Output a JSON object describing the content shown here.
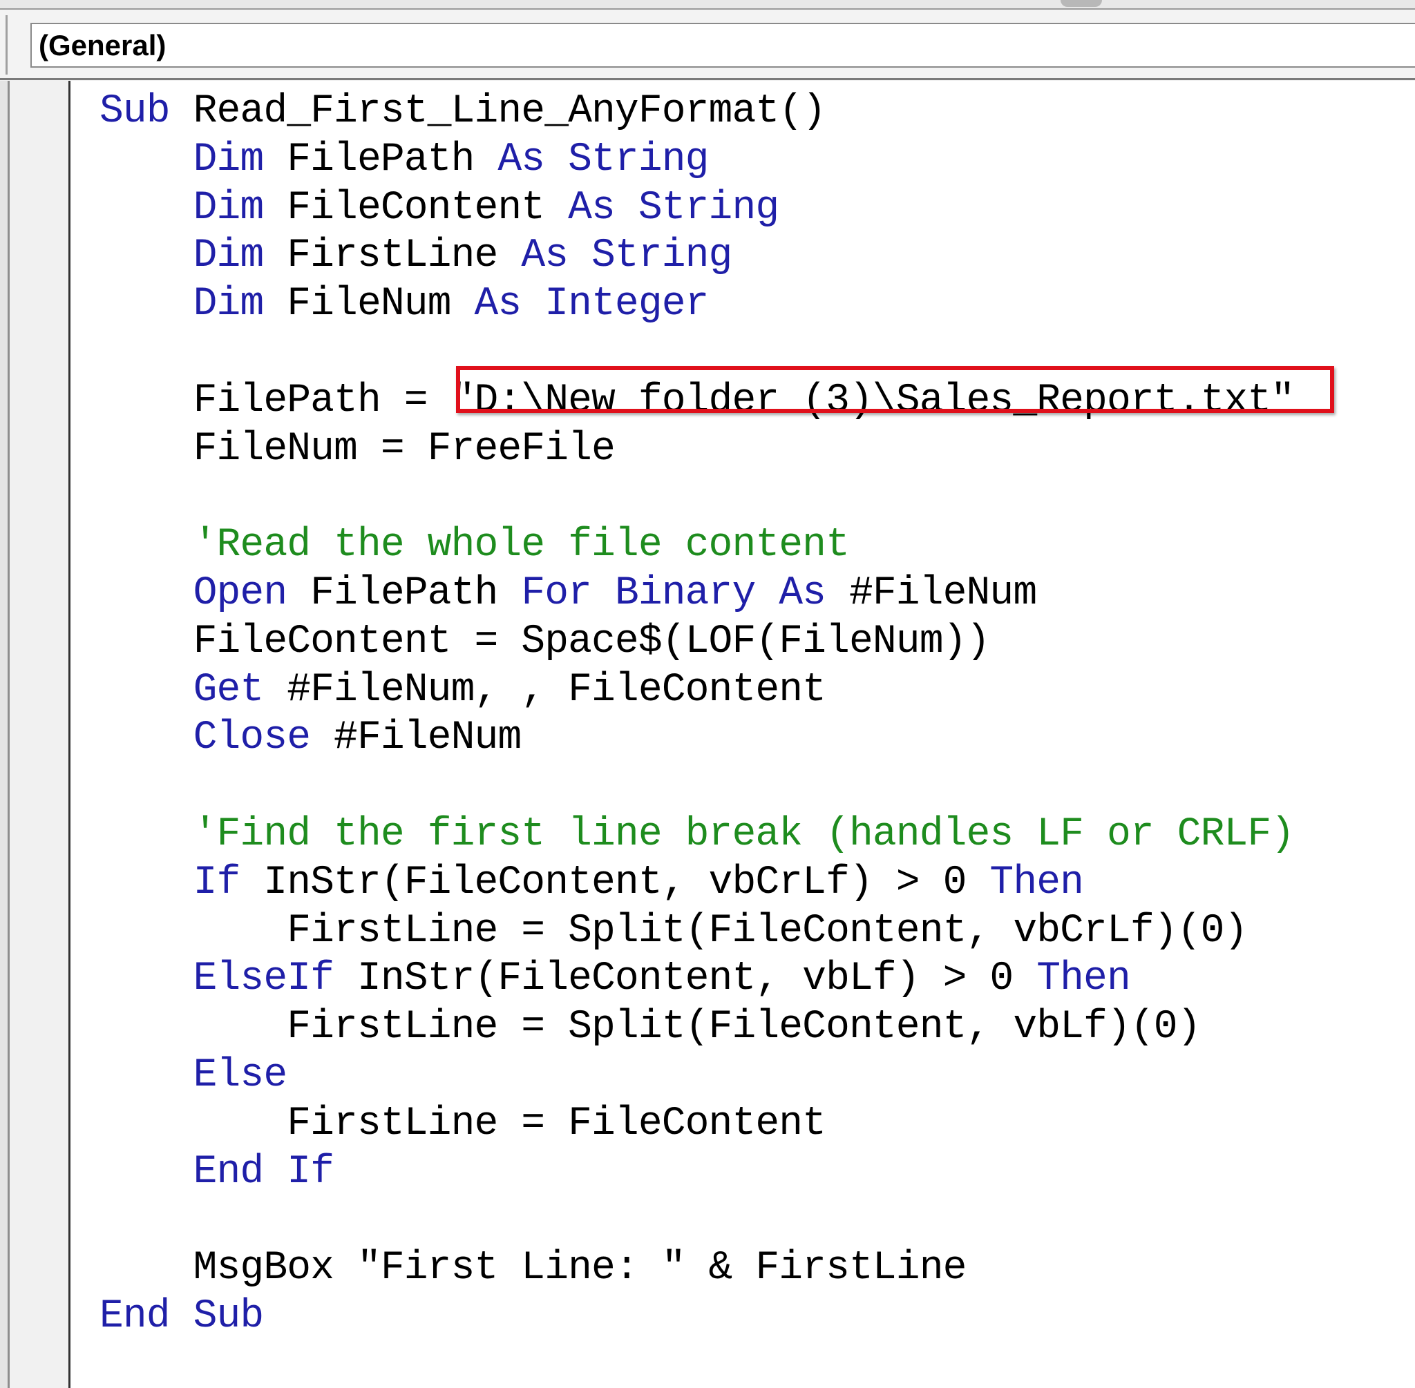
{
  "toolbar": {
    "object_combo_value": "(General)"
  },
  "code_lines": [
    [
      {
        "t": "Sub",
        "k": "kw"
      },
      {
        "t": " Read_First_Line_AnyFormat()",
        "k": "tx"
      }
    ],
    [
      {
        "t": "    ",
        "k": "tx"
      },
      {
        "t": "Dim",
        "k": "kw"
      },
      {
        "t": " FilePath ",
        "k": "tx"
      },
      {
        "t": "As",
        "k": "kw"
      },
      {
        "t": " ",
        "k": "tx"
      },
      {
        "t": "String",
        "k": "kw"
      }
    ],
    [
      {
        "t": "    ",
        "k": "tx"
      },
      {
        "t": "Dim",
        "k": "kw"
      },
      {
        "t": " FileContent ",
        "k": "tx"
      },
      {
        "t": "As",
        "k": "kw"
      },
      {
        "t": " ",
        "k": "tx"
      },
      {
        "t": "String",
        "k": "kw"
      }
    ],
    [
      {
        "t": "    ",
        "k": "tx"
      },
      {
        "t": "Dim",
        "k": "kw"
      },
      {
        "t": " FirstLine ",
        "k": "tx"
      },
      {
        "t": "As",
        "k": "kw"
      },
      {
        "t": " ",
        "k": "tx"
      },
      {
        "t": "String",
        "k": "kw"
      }
    ],
    [
      {
        "t": "    ",
        "k": "tx"
      },
      {
        "t": "Dim",
        "k": "kw"
      },
      {
        "t": " FileNum ",
        "k": "tx"
      },
      {
        "t": "As",
        "k": "kw"
      },
      {
        "t": " ",
        "k": "tx"
      },
      {
        "t": "Integer",
        "k": "kw"
      }
    ],
    [],
    [
      {
        "t": "    FilePath = \"D:\\New folder (3)\\Sales_Report.txt\"",
        "k": "tx"
      }
    ],
    [
      {
        "t": "    FileNum = FreeFile",
        "k": "tx"
      }
    ],
    [],
    [
      {
        "t": "    ",
        "k": "tx"
      },
      {
        "t": "'Read the whole file content",
        "k": "cm"
      }
    ],
    [
      {
        "t": "    ",
        "k": "tx"
      },
      {
        "t": "Open",
        "k": "kw"
      },
      {
        "t": " FilePath ",
        "k": "tx"
      },
      {
        "t": "For",
        "k": "kw"
      },
      {
        "t": " ",
        "k": "tx"
      },
      {
        "t": "Binary",
        "k": "kw"
      },
      {
        "t": " ",
        "k": "tx"
      },
      {
        "t": "As",
        "k": "kw"
      },
      {
        "t": " #FileNum",
        "k": "tx"
      }
    ],
    [
      {
        "t": "    FileContent = Space$(LOF(FileNum))",
        "k": "tx"
      }
    ],
    [
      {
        "t": "    ",
        "k": "tx"
      },
      {
        "t": "Get",
        "k": "kw"
      },
      {
        "t": " #FileNum, , FileContent",
        "k": "tx"
      }
    ],
    [
      {
        "t": "    ",
        "k": "tx"
      },
      {
        "t": "Close",
        "k": "kw"
      },
      {
        "t": " #FileNum",
        "k": "tx"
      }
    ],
    [],
    [
      {
        "t": "    ",
        "k": "tx"
      },
      {
        "t": "'Find the first line break (handles LF or CRLF)",
        "k": "cm"
      }
    ],
    [
      {
        "t": "    ",
        "k": "tx"
      },
      {
        "t": "If",
        "k": "kw"
      },
      {
        "t": " InStr(FileContent, vbCrLf) > 0 ",
        "k": "tx"
      },
      {
        "t": "Then",
        "k": "kw"
      }
    ],
    [
      {
        "t": "        FirstLine = Split(FileContent, vbCrLf)(0)",
        "k": "tx"
      }
    ],
    [
      {
        "t": "    ",
        "k": "tx"
      },
      {
        "t": "ElseIf",
        "k": "kw"
      },
      {
        "t": " InStr(FileContent, vbLf) > 0 ",
        "k": "tx"
      },
      {
        "t": "Then",
        "k": "kw"
      }
    ],
    [
      {
        "t": "        FirstLine = Split(FileContent, vbLf)(0)",
        "k": "tx"
      }
    ],
    [
      {
        "t": "    ",
        "k": "tx"
      },
      {
        "t": "Else",
        "k": "kw"
      }
    ],
    [
      {
        "t": "        FirstLine = FileContent",
        "k": "tx"
      }
    ],
    [
      {
        "t": "    ",
        "k": "tx"
      },
      {
        "t": "End",
        "k": "kw"
      },
      {
        "t": " ",
        "k": "tx"
      },
      {
        "t": "If",
        "k": "kw"
      }
    ],
    [],
    [
      {
        "t": "    MsgBox \"First Line: \" & FirstLine",
        "k": "tx"
      }
    ],
    [
      {
        "t": "End",
        "k": "kw"
      },
      {
        "t": " ",
        "k": "tx"
      },
      {
        "t": "Sub",
        "k": "kw"
      }
    ]
  ],
  "colors": {
    "keyword": "#1f1fa8",
    "comment": "#1e8c1e",
    "text": "#000000",
    "highlight_box": "#e0101b"
  }
}
